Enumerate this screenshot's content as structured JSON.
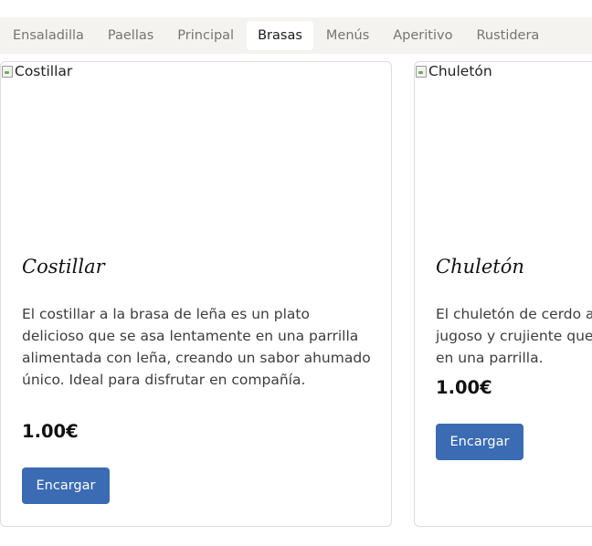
{
  "tabs": [
    {
      "label": "Ensaladilla",
      "active": false
    },
    {
      "label": "Paellas",
      "active": false
    },
    {
      "label": "Principal",
      "active": false
    },
    {
      "label": "Brasas",
      "active": true
    },
    {
      "label": "Menús",
      "active": false
    },
    {
      "label": "Aperitivo",
      "active": false
    },
    {
      "label": "Rustidera",
      "active": false
    }
  ],
  "products": [
    {
      "image_alt": "Costillar",
      "title": "Costillar",
      "description": "El costillar a la brasa de leña es un plato delicioso que se asa lentamente en una parrilla alimentada con leña, creando un sabor ahumado único. Ideal para disfrutar en compañía.",
      "price": "1.00€",
      "button_label": "Encargar"
    },
    {
      "image_alt": "Chuletón",
      "title": "Chuletón",
      "description_lines": [
        "El chuletón de cerdo a",
        "jugoso y crujiente que",
        "en una parrilla."
      ],
      "price": "1.00€",
      "button_label": "Encargar"
    }
  ],
  "colors": {
    "tabbar_bg": "#f4f3f0",
    "active_tab_bg": "#ffffff",
    "button_bg": "#3a6bb3",
    "card_border": "#dddddd"
  }
}
